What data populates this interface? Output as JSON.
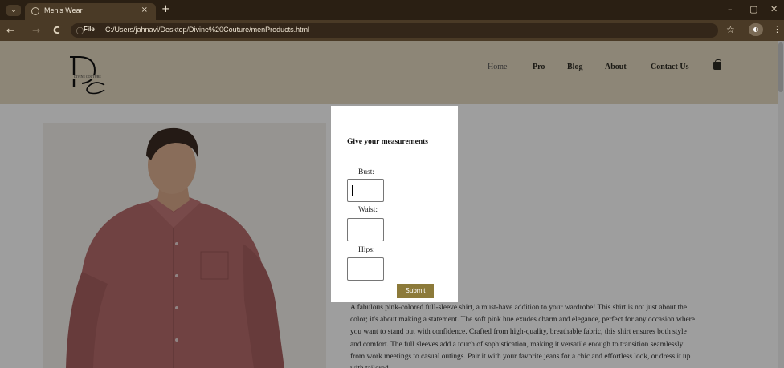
{
  "browser": {
    "tab_title": "Men's Wear",
    "new_tab": "+",
    "tab_close": "×",
    "url_chip": "File",
    "url": "C:/Users/jahnavi/Desktop/Divine%20Couture/menProducts.html",
    "back": "←",
    "forward": "→",
    "reload": "C",
    "info": "ⓘ",
    "star": "☆",
    "kebab": "⋮",
    "minimize": "–",
    "maximize": "▢",
    "close": "✕"
  },
  "header": {
    "logo_text": "DIVINE COUTURE",
    "nav": [
      "Home",
      "Pro",
      "Blog",
      "About",
      "Contact Us"
    ],
    "cart_icon": "shopping-bag-icon"
  },
  "product": {
    "description": "A fabulous pink-colored full-sleeve shirt, a must-have addition to your wardrobe! This shirt is not just about the color; it's about making a statement. The soft pink hue exudes charm and elegance, perfect for any occasion where you want to stand out with confidence. Crafted from high-quality, breathable fabric, this shirt ensures both style and comfort. The full sleeves add a touch of sophistication, making it versatile enough to transition seamlessly from work meetings to casual outings. Pair it with your favorite jeans for a chic and effortless look, or dress it up with tailored"
  },
  "modal": {
    "title": "Give your measurements",
    "bust_label": "Bust:",
    "waist_label": "Waist:",
    "hips_label": "Hips:",
    "bust_value": "",
    "waist_value": "",
    "hips_value": "",
    "submit_label": "Submit"
  },
  "colors": {
    "header_bg": "#e4d8c0",
    "submit_bg": "#8c7a3a",
    "chrome_bg": "#2a1f13"
  }
}
